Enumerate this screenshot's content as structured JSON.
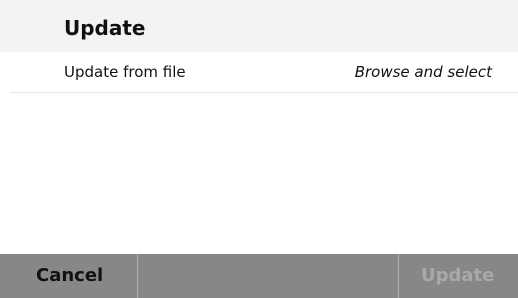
{
  "section": {
    "title": "Update"
  },
  "rows": [
    {
      "label": "Update from file",
      "value": "Browse and select"
    }
  ],
  "footer": {
    "cancel_label": "Cancel",
    "update_label": "Update"
  }
}
